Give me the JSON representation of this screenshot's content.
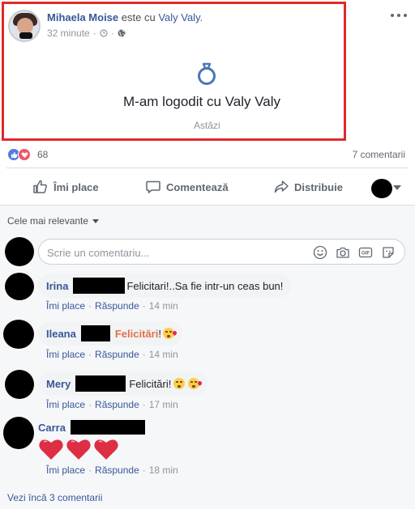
{
  "post": {
    "author": "Mihaela Moise",
    "verb": "este cu",
    "tagged": "Valy Valy.",
    "time": "32 minute",
    "meta_sep": "·",
    "life_event": "M-am logodit cu Valy Valy",
    "life_event_date": "Astăzi"
  },
  "stats": {
    "reactions_count": "68",
    "comments_count": "7 comentarii"
  },
  "actions": {
    "like_label": "Îmi place",
    "comment_label": "Comentează",
    "share_label": "Distribuie"
  },
  "comments_section": {
    "sort_label": "Cele mai relevante",
    "composer_placeholder": "Scrie un comentariu...",
    "reply_like": "Îmi place",
    "reply_reply": "Răspunde",
    "sep": "·",
    "more_link": "Vezi încă 3 comentarii"
  },
  "comments": [
    {
      "name": "Irina",
      "text": "Felicitari!..Sa fie intr-un ceas bun!",
      "time": "14 min"
    },
    {
      "name": "Ileana",
      "text": "Felicitări",
      "suffix": "!",
      "time": "14 min"
    },
    {
      "name": "Mery",
      "text": "Felicitări!",
      "time": "17 min"
    },
    {
      "name": "Carra",
      "time": "18 min"
    }
  ],
  "colors": {
    "link_blue": "#385898",
    "highlight_red": "#e02a2a",
    "heart_red": "#dd2e44"
  },
  "icons": [
    "more-icon",
    "clock-icon",
    "globe-icon",
    "ring-icon",
    "like-icon",
    "comment-icon",
    "share-icon",
    "emoji-icon",
    "camera-icon",
    "gif-icon",
    "sticker-icon",
    "heart-icon"
  ]
}
